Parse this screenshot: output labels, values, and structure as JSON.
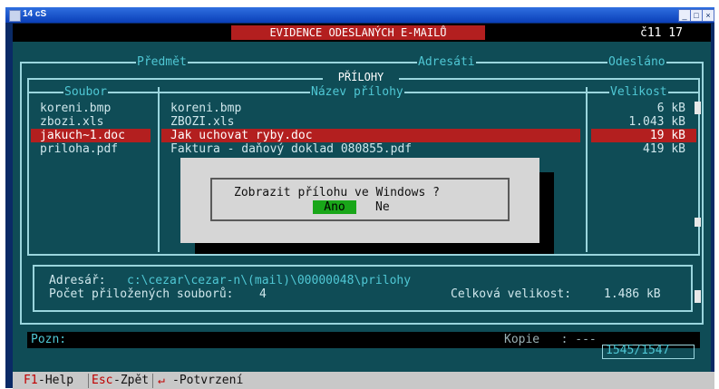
{
  "window": {
    "title": "14 cS"
  },
  "header": {
    "title": "EVIDENCE ODESLANÝCH E-MAILŮ",
    "right": "č11 17"
  },
  "top_columns": {
    "predmet": "Předmět",
    "adresati": "Adresáti",
    "odeslano": "Odesláno"
  },
  "attachments": {
    "title": "PŘÍLOHY",
    "col_file": "Soubor",
    "col_name": "Název přílohy",
    "col_size": "Velikost",
    "rows": [
      {
        "file": "koreni.bmp",
        "name": "koreni.bmp",
        "size": "6 kB"
      },
      {
        "file": "zbozi.xls",
        "name": "ZBOZI.xls",
        "size": "1.043 kB"
      },
      {
        "file": "jakuch~1.doc",
        "name": "Jak uchovat ryby.doc",
        "size": "19 kB"
      },
      {
        "file": "priloha.pdf",
        "name": "Faktura - daňový doklad 080855.pdf",
        "size": "419 kB"
      }
    ]
  },
  "dialog": {
    "question": "Zobrazit přílohu ve Windows ?",
    "yes": "Ano",
    "no": "Ne"
  },
  "info": {
    "dir_label": "Adresář:",
    "dir_value": "c:\\cezar\\cezar-n\\(mail)\\00000048\\prilohy",
    "count_label": "Počet přiložených souborů:",
    "count_value": "4",
    "total_label": "Celková velikost:",
    "total_value": "1.486 kB"
  },
  "footer": {
    "pozn": "Pozn:",
    "kopie": "Kopie   : ---",
    "counter": "1545/1547"
  },
  "fkeys": [
    {
      "key": "F1",
      "label": "-Help"
    },
    {
      "key": "Esc",
      "label": "-Zpět"
    },
    {
      "key": "↵",
      "label": "-Potvrzení"
    }
  ]
}
